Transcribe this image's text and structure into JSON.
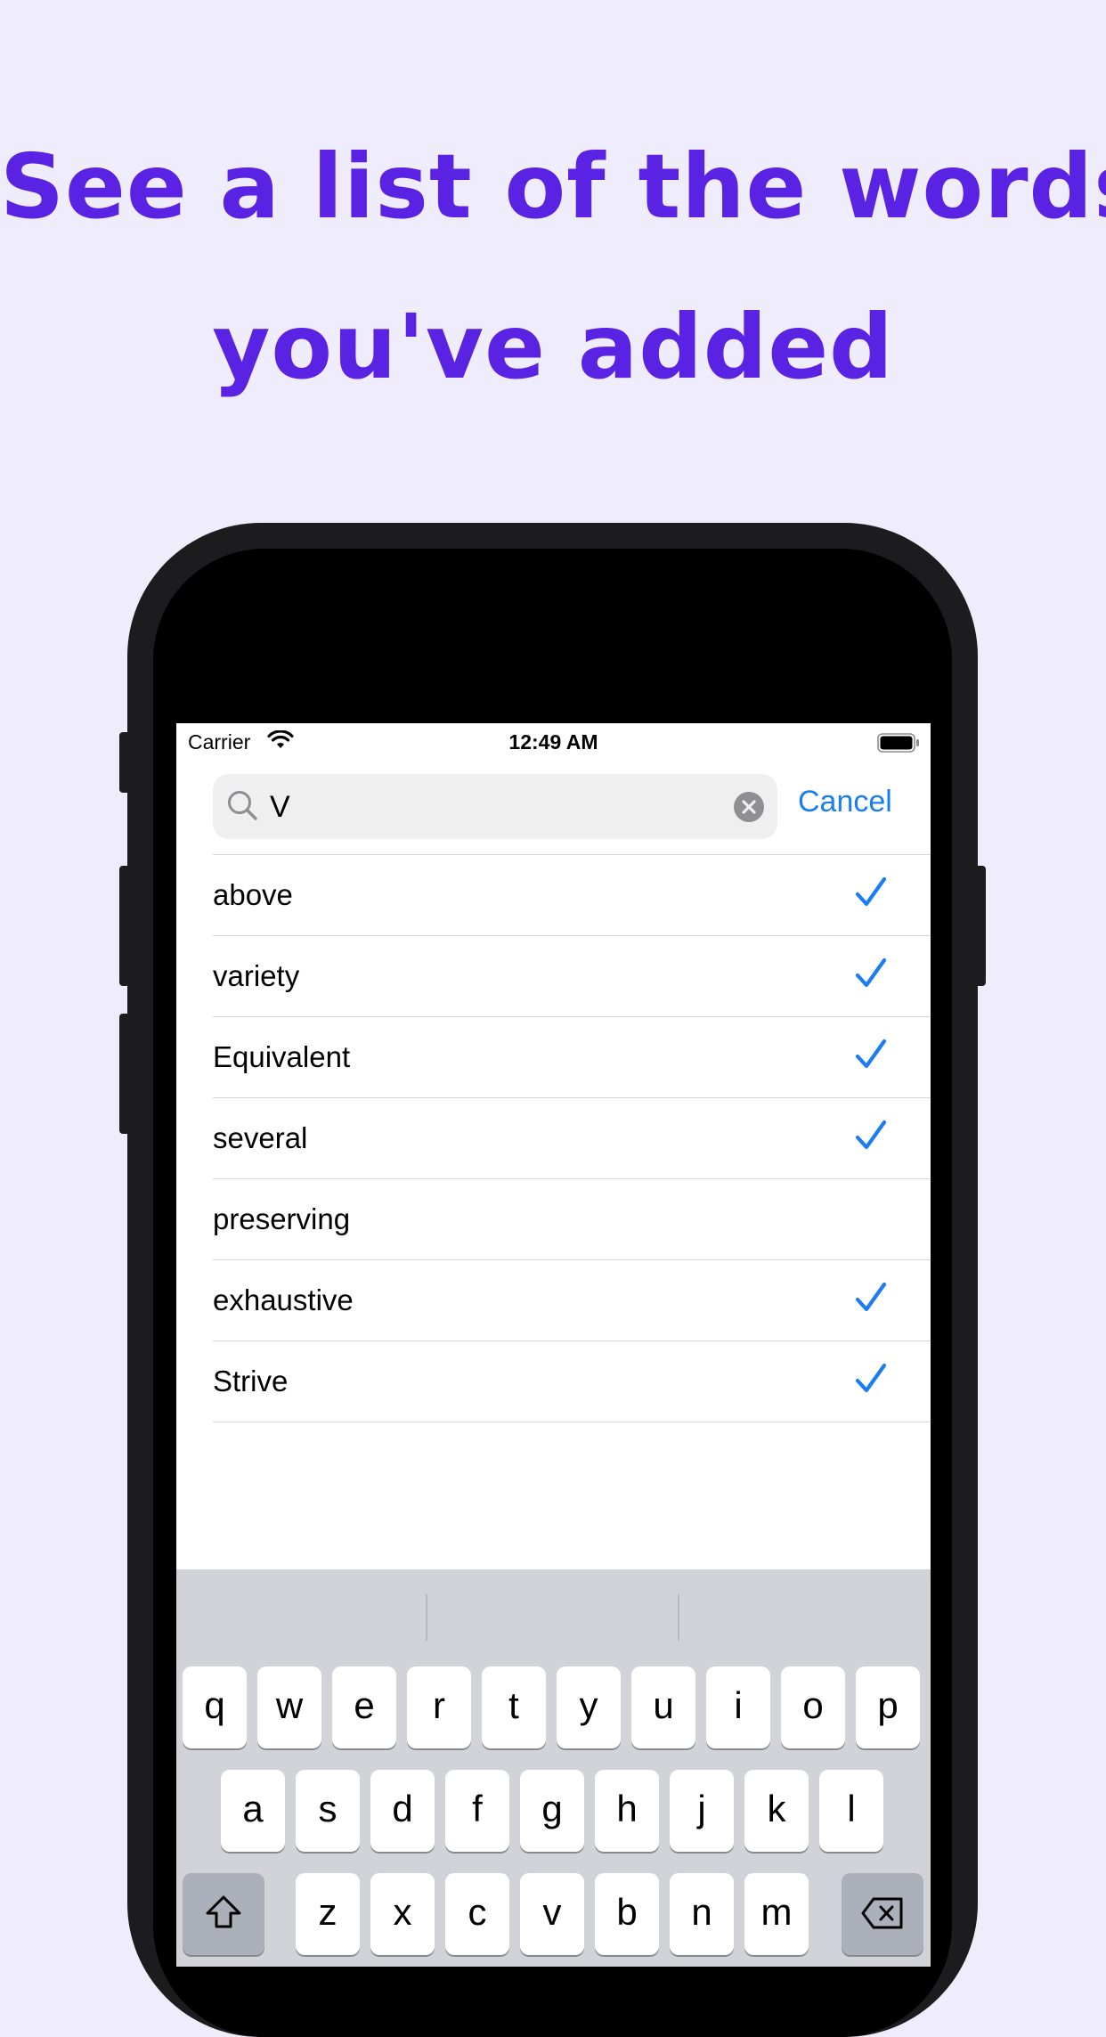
{
  "headline": {
    "line1": "See a list of the words",
    "line2": "you've added"
  },
  "status_bar": {
    "carrier": "Carrier",
    "time": "12:49 AM"
  },
  "search": {
    "value": "V",
    "cancel_label": "Cancel"
  },
  "words": [
    {
      "text": "above",
      "checked": true
    },
    {
      "text": "variety",
      "checked": true
    },
    {
      "text": "Equivalent",
      "checked": true
    },
    {
      "text": "several",
      "checked": true
    },
    {
      "text": "preserving",
      "checked": false
    },
    {
      "text": "exhaustive",
      "checked": true
    },
    {
      "text": "Strive",
      "checked": true
    }
  ],
  "keyboard": {
    "row1": [
      "q",
      "w",
      "e",
      "r",
      "t",
      "y",
      "u",
      "i",
      "o",
      "p"
    ],
    "row2": [
      "a",
      "s",
      "d",
      "f",
      "g",
      "h",
      "j",
      "k",
      "l"
    ],
    "row3": [
      "z",
      "x",
      "c",
      "v",
      "b",
      "n",
      "m"
    ]
  },
  "colors": {
    "accent": "#1a7df6",
    "headline": "#5a22e2",
    "background": "#efecfb"
  }
}
